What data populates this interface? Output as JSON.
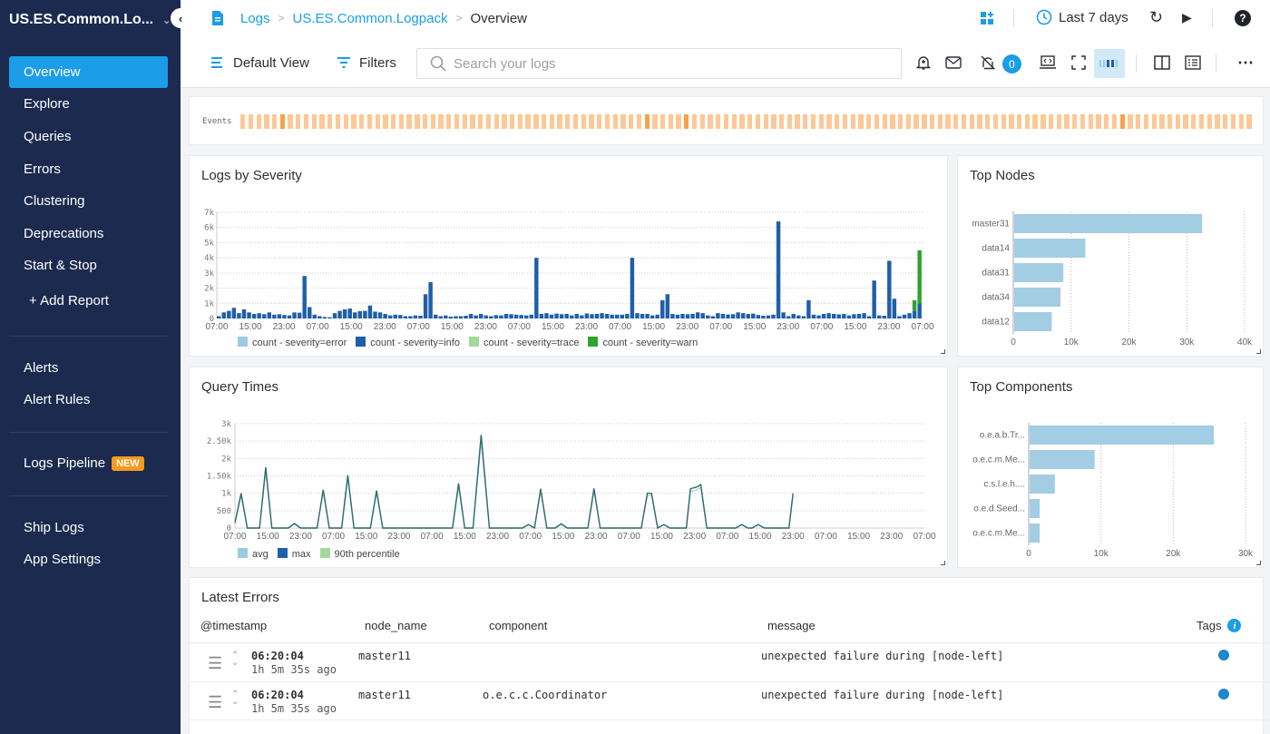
{
  "sidebar": {
    "app_name": "US.ES.Common.Lo...",
    "items": [
      {
        "label": "Overview",
        "active": true
      },
      {
        "label": "Explore"
      },
      {
        "label": "Queries"
      },
      {
        "label": "Errors"
      },
      {
        "label": "Clustering"
      },
      {
        "label": "Deprecations"
      },
      {
        "label": "Start & Stop"
      }
    ],
    "add_report": "+ Add Report",
    "alerts": "Alerts",
    "alert_rules": "Alert Rules",
    "logs_pipeline": "Logs Pipeline",
    "new_badge": "NEW",
    "ship_logs": "Ship Logs",
    "app_settings": "App Settings"
  },
  "header": {
    "breadcrumb": [
      "Logs",
      "US.ES.Common.Logpack",
      "Overview"
    ],
    "time_range": "Last 7 days"
  },
  "toolbar": {
    "default_view": "Default View",
    "filters": "Filters",
    "search_placeholder": "Search your logs",
    "notifications_count": "0"
  },
  "events": {
    "label": "Events",
    "count": 128,
    "highlight_indices": [
      5,
      51,
      56,
      111
    ]
  },
  "chart_data": [
    {
      "type": "bar",
      "title": "Logs by Severity",
      "xticks": [
        "07:00",
        "15:00",
        "23:00",
        "07:00",
        "15:00",
        "23:00",
        "07:00",
        "15:00",
        "23:00",
        "07:00",
        "15:00",
        "23:00",
        "07:00",
        "15:00",
        "23:00",
        "07:00",
        "15:00",
        "23:00",
        "07:00",
        "15:00",
        "23:00",
        "07:00"
      ],
      "yticks": [
        "0",
        "1k",
        "2k",
        "3k",
        "4k",
        "5k",
        "6k",
        "7k"
      ],
      "ylim": [
        0,
        7000
      ],
      "stacked": true,
      "series": [
        {
          "name": "count - severity=error",
          "color": "#9ecae1"
        },
        {
          "name": "count - severity=info",
          "color": "#1f5fa8",
          "values": [
            150,
            400,
            500,
            700,
            350,
            600,
            400,
            300,
            350,
            280,
            400,
            250,
            280,
            230,
            200,
            400,
            380,
            2800,
            750,
            250,
            150,
            100,
            80,
            350,
            500,
            600,
            650,
            400,
            480,
            500,
            850,
            450,
            400,
            300,
            200,
            250,
            230,
            150,
            150,
            200,
            180,
            1600,
            2400,
            250,
            150,
            200,
            120,
            150,
            150,
            180,
            300,
            200,
            300,
            200,
            150,
            220,
            200,
            300,
            280,
            250,
            230,
            200,
            250,
            4000,
            300,
            350,
            250,
            320,
            280,
            300,
            200,
            300,
            200,
            330,
            280,
            300,
            350,
            300,
            250,
            250,
            250,
            300,
            4000,
            350,
            300,
            300,
            200,
            250,
            1200,
            1600,
            300,
            250,
            300,
            280,
            300,
            400,
            350,
            200,
            150,
            350,
            300,
            260,
            280,
            400,
            350,
            300,
            320,
            230,
            180,
            200,
            250,
            6400,
            400,
            150,
            300,
            200,
            150,
            1200,
            250,
            200,
            300,
            350,
            300,
            270,
            300,
            200,
            280,
            300,
            350,
            150,
            2500,
            200,
            180,
            3800,
            1300,
            150,
            250,
            350,
            500,
            1000
          ]
        },
        {
          "name": "count - severity=trace",
          "color": "#a1d99b"
        },
        {
          "name": "count - severity=warn",
          "color": "#31a22d",
          "last_bar_total": 4500,
          "prev_bar_total": 1200
        }
      ],
      "legend": "bottom"
    },
    {
      "type": "bar",
      "title": "Top Nodes",
      "orientation": "horizontal",
      "categories": [
        "master31",
        "data14",
        "data31",
        "data34",
        "data12"
      ],
      "values": [
        32500,
        12300,
        8500,
        8000,
        6500
      ],
      "xticks": [
        "0",
        "10k",
        "20k",
        "30k",
        "40k"
      ],
      "xlim": [
        0,
        40000
      ],
      "color": "#a3cde3"
    },
    {
      "type": "line",
      "title": "Query Times",
      "xticks": [
        "07:00",
        "15:00",
        "23:00",
        "07:00",
        "15:00",
        "23:00",
        "07:00",
        "15:00",
        "23:00",
        "07:00",
        "15:00",
        "23:00",
        "07:00",
        "15:00",
        "23:00",
        "07:00",
        "15:00",
        "23:00",
        "07:00",
        "15:00",
        "23:00",
        "07:00"
      ],
      "yticks": [
        "0",
        "500",
        "1k",
        "1.50k",
        "2k",
        "2.50k",
        "3k"
      ],
      "ylim": [
        0,
        3000
      ],
      "x_range_hours": [
        0,
        168
      ],
      "series": [
        {
          "name": "avg",
          "color": "#9ecae1"
        },
        {
          "name": "max",
          "color": "#1f5fa8",
          "points": [
            [
              0,
              150
            ],
            [
              1.5,
              1000
            ],
            [
              3,
              0
            ],
            [
              6,
              0
            ],
            [
              7.5,
              1750
            ],
            [
              9,
              0
            ],
            [
              13,
              0
            ],
            [
              14.5,
              130
            ],
            [
              16,
              0
            ],
            [
              20,
              0
            ],
            [
              21.5,
              1100
            ],
            [
              23,
              0
            ],
            [
              26,
              0
            ],
            [
              27.5,
              1520
            ],
            [
              29,
              0
            ],
            [
              33,
              0
            ],
            [
              34.5,
              1080
            ],
            [
              36,
              0
            ],
            [
              53,
              0
            ],
            [
              54.5,
              1280
            ],
            [
              56,
              0
            ],
            [
              58,
              0
            ],
            [
              60,
              2680
            ],
            [
              62,
              0
            ],
            [
              70,
              0
            ],
            [
              71.5,
              100
            ],
            [
              73,
              0
            ],
            [
              74.5,
              1130
            ],
            [
              76,
              0
            ],
            [
              78,
              0
            ],
            [
              79.5,
              120
            ],
            [
              81,
              0
            ],
            [
              86,
              0
            ],
            [
              87.5,
              1140
            ],
            [
              89,
              0
            ],
            [
              99,
              0
            ],
            [
              100.5,
              1000
            ],
            [
              101.5,
              1000
            ],
            [
              103,
              0
            ],
            [
              104.5,
              100
            ],
            [
              106,
              0
            ],
            [
              110,
              0
            ],
            [
              111,
              1130
            ],
            [
              112.5,
              1180
            ],
            [
              113.5,
              1250
            ],
            [
              115,
              0
            ],
            [
              122,
              0
            ],
            [
              123.5,
              100
            ],
            [
              125,
              0
            ],
            [
              126,
              0
            ],
            [
              127.5,
              100
            ],
            [
              129,
              0
            ],
            [
              135,
              0
            ],
            [
              136,
              1000
            ]
          ]
        },
        {
          "name": "90th percentile",
          "color": "#a1d99b"
        }
      ],
      "line_color": "#2d6b6a",
      "legend": "bottom"
    },
    {
      "type": "bar",
      "title": "Top Components",
      "orientation": "horizontal",
      "categories": [
        "o.e.a.b.Tr...",
        "o.e.c.m.Me...",
        "c.s.l.e.h....",
        "o.e.d.Seed...",
        "o.e.c.m.Me..."
      ],
      "values": [
        25500,
        9000,
        3500,
        1400,
        1400
      ],
      "xticks": [
        "0",
        "10k",
        "20k",
        "30k"
      ],
      "xlim": [
        0,
        30000
      ],
      "color": "#a3cde3"
    }
  ],
  "latest_errors": {
    "title": "Latest Errors",
    "columns": [
      "@timestamp",
      "node_name",
      "component",
      "message",
      "Tags"
    ],
    "rows": [
      {
        "time": "06:20:04",
        "ago": "1h 5m 35s ago",
        "node": "master11",
        "component": "",
        "message": "unexpected failure during [node-left]"
      },
      {
        "time": "06:20:04",
        "ago": "1h 5m 35s ago",
        "node": "master11",
        "component": "o.e.c.c.Coordinator",
        "message": "unexpected failure during [node-left]"
      }
    ]
  }
}
